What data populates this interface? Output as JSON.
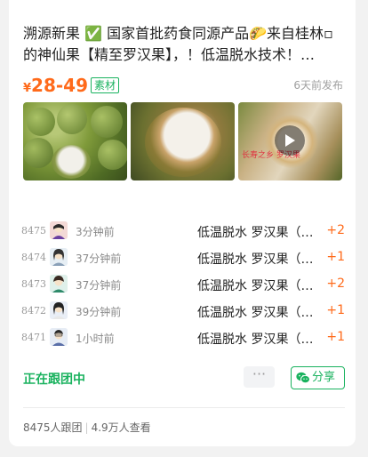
{
  "post": {
    "title": "溯源新果 ✅ 国家首批药食同源产品🌮来自桂林▫的神仙果【精至罗汉果】，！低温脱水技术！…",
    "price_symbol": "¥",
    "price_range": "28-49",
    "tag": "素材",
    "posted": "6天前发布",
    "video_caption": "长寿之乡 罗汉果"
  },
  "orders": [
    {
      "num": "8475",
      "time": "3分钟前",
      "item": "低温脱水 罗汉果（…",
      "qty": "+2"
    },
    {
      "num": "8474",
      "time": "37分钟前",
      "item": "低温脱水 罗汉果（…",
      "qty": "+1"
    },
    {
      "num": "8473",
      "time": "37分钟前",
      "item": "低温脱水 罗汉果（…",
      "qty": "+2"
    },
    {
      "num": "8472",
      "time": "39分钟前",
      "item": "低温脱水 罗汉果（…",
      "qty": "+1"
    },
    {
      "num": "8471",
      "time": "1小时前",
      "item": "低温脱水 罗汉果（…",
      "qty": "+1"
    }
  ],
  "actions": {
    "status": "正在跟团中",
    "more": "···",
    "share": "分享"
  },
  "footer": {
    "followers": "8475人跟团",
    "views": "4.9万人查看"
  },
  "colors": {
    "accent_green": "#19b25e",
    "price_orange": "#ff6a1a"
  }
}
